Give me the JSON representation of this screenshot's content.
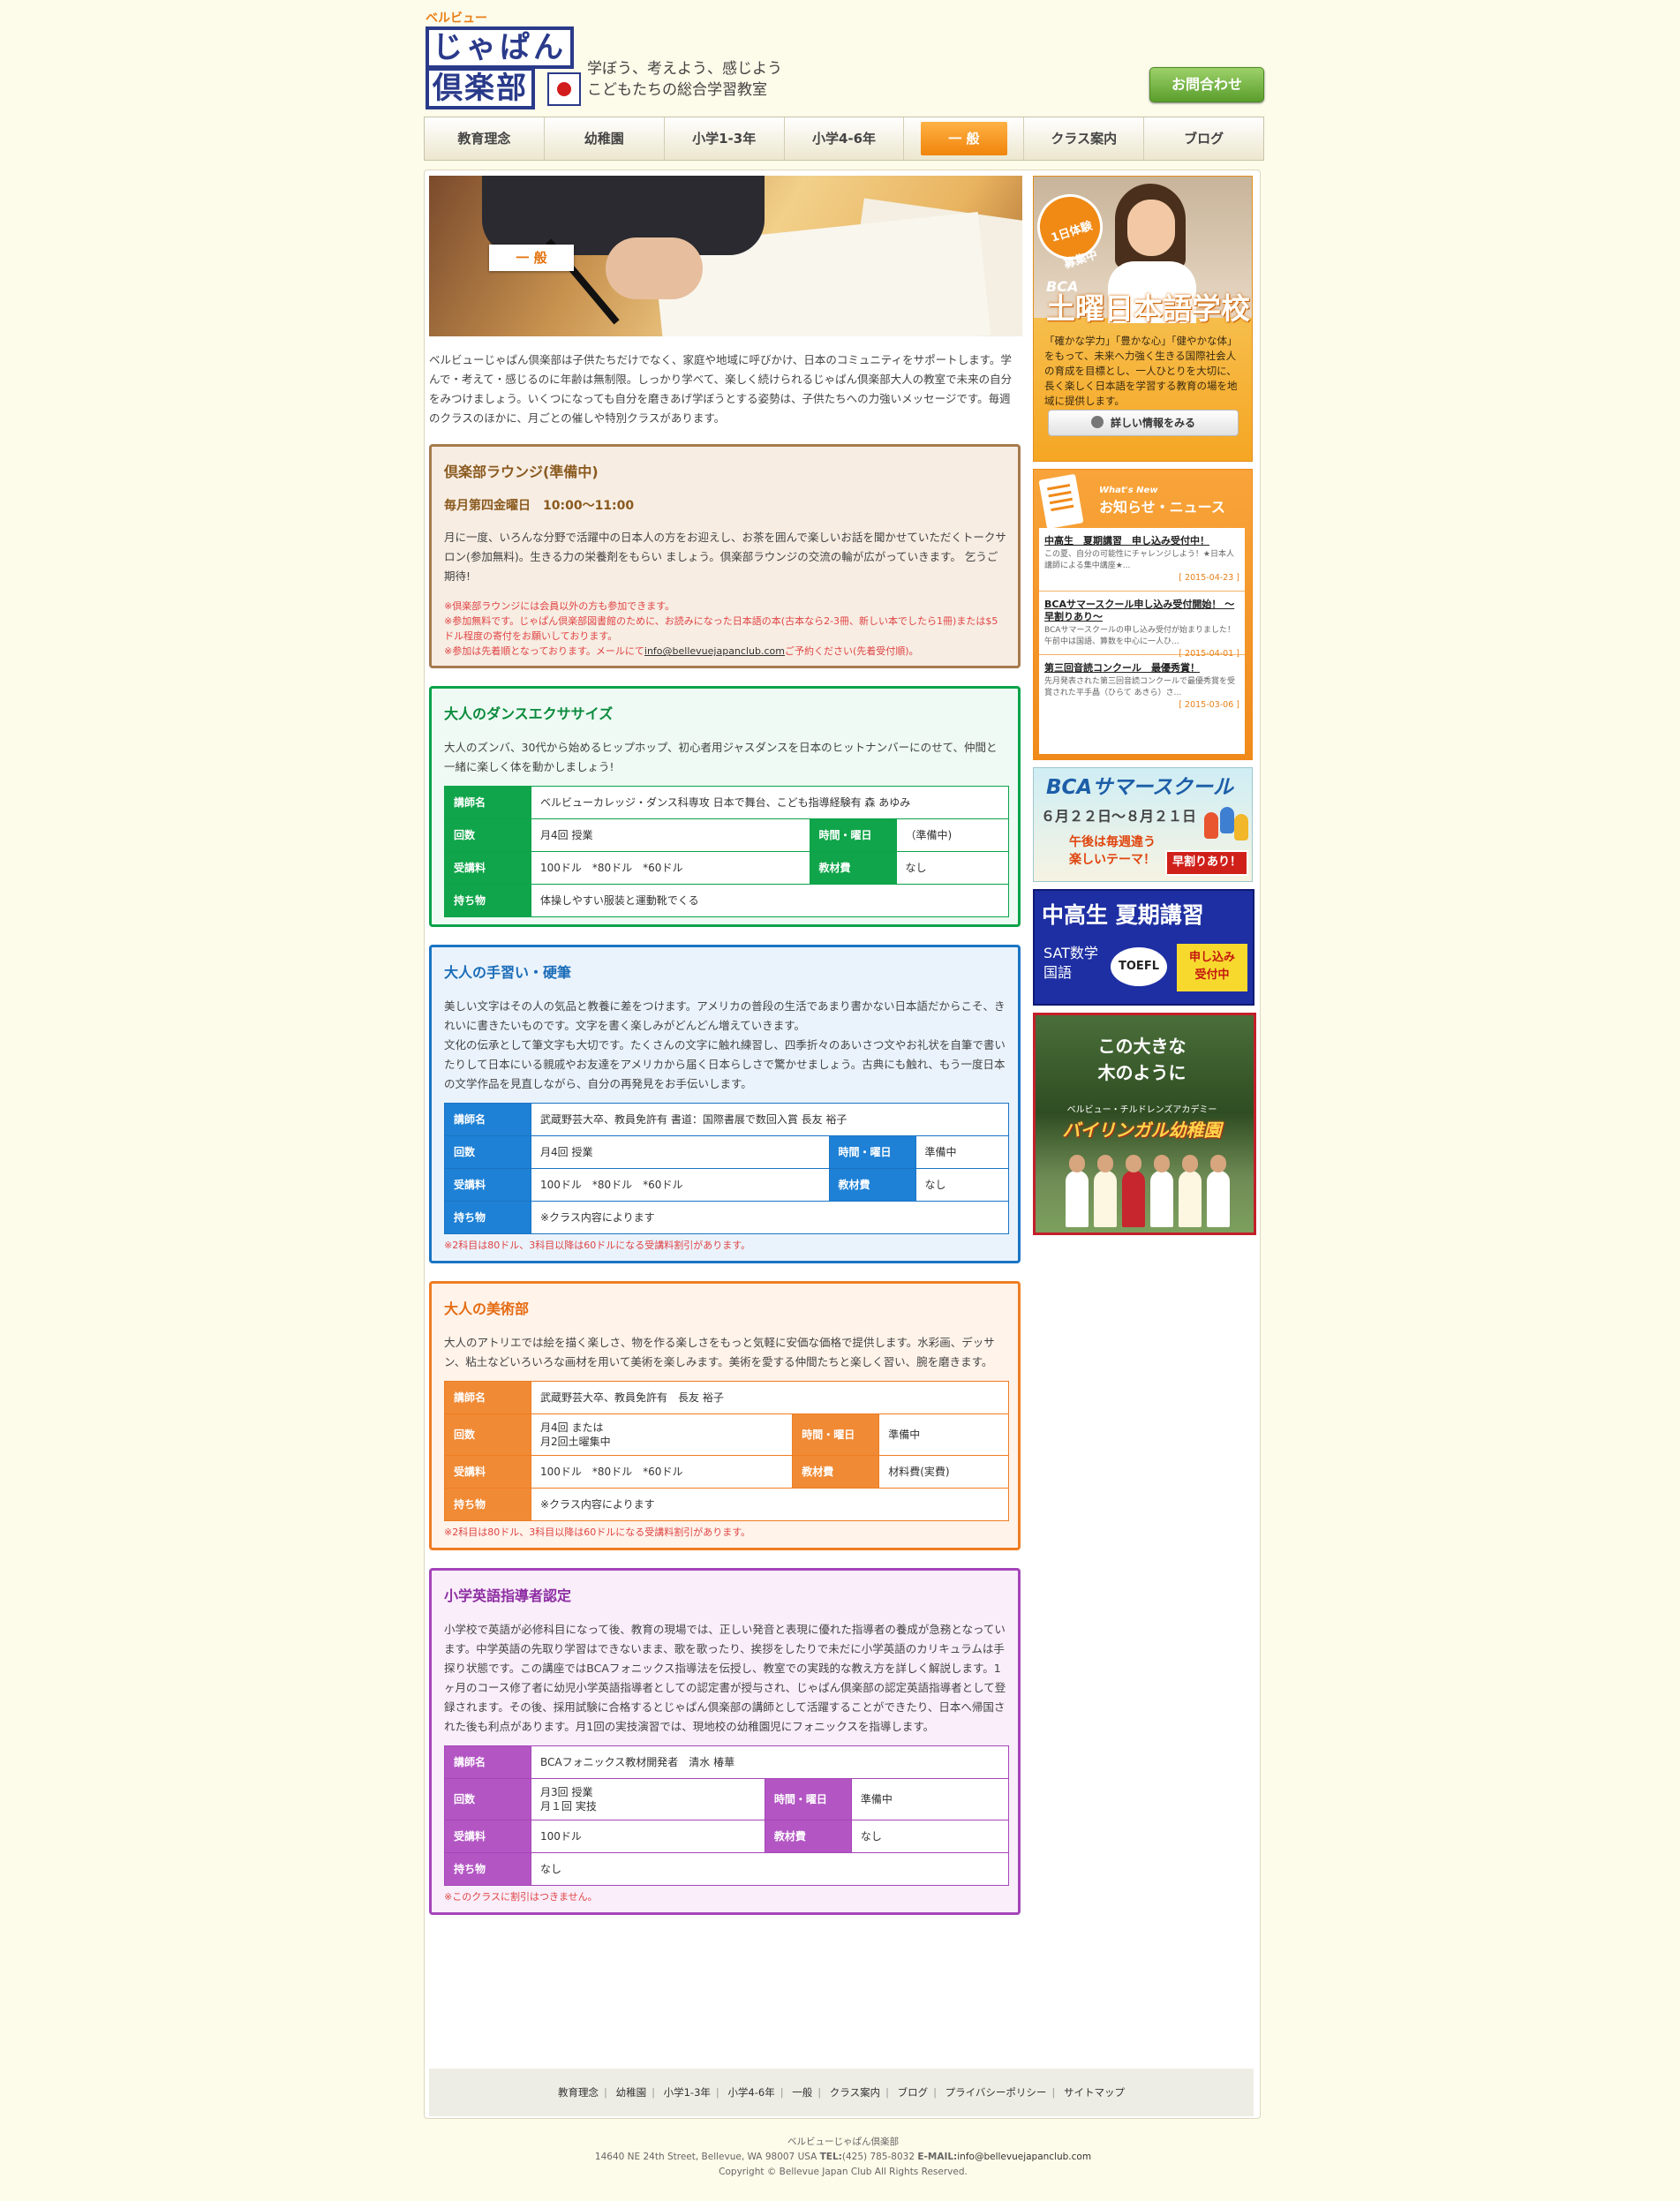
{
  "header": {
    "logo_kana": "ベルビュー",
    "logo_line1": "じゃぱん",
    "logo_line2": "倶楽部",
    "tagline_1": "学ぼう、考えよう、感じよう",
    "tagline_2": "こどもたちの総合学習教室",
    "contact_label": "お問合わせ"
  },
  "nav": {
    "items": [
      "教育理念",
      "幼稚園",
      "小学1-3年",
      "小学4-6年",
      "一 般",
      "クラス案内",
      "ブログ"
    ],
    "active_index": 4
  },
  "hero": {
    "badge": "一 般"
  },
  "intro": "ベルビューじゃぱん倶楽部は子供たちだけでなく、家庭や地域に呼びかけ、日本のコミュニティをサポートします。学んで・考えて・感じるのに年齢は無制限。しっかり学べて、楽しく続けられるじゃぱん倶楽部大人の教室で未来の自分をみつけましょう。いくつになっても自分を磨きあげ学ぼうとする姿勢は、子供たちへの力強いメッセージです。毎週のクラスのほかに、月ごとの催しや特別クラスがあります。",
  "sections": {
    "lounge": {
      "title": "倶楽部ラウンジ(準備中)",
      "schedule": "毎月第四金曜日　10:00～11:00",
      "body": "月に一度、いろんな分野で活躍中の日本人の方をお迎えし、お茶を囲んで楽しいお話を聞かせていただくトークサロン(参加無料)。生きる力の栄養剤をもらい ましょう。倶楽部ラウンジの交流の輪が広がっていきます。 乞うご期待!",
      "note1": "※倶楽部ラウンジには会員以外の方も参加できます。",
      "note2": "※参加無料です。じゃぱん倶楽部図書館のために、お読みになった日本語の本(古本なら2-3冊、新しい本でしたら1冊)または$5ドル程度の寄付をお願いしております。",
      "note3a": "※参加は先着順となっております。メールにて",
      "note3_email": "info@bellevuejapanclub.com",
      "note3b": "ご予約ください(先着受付順)。"
    },
    "dance": {
      "title": "大人のダンスエクササイズ",
      "body": "大人のズンバ、30代から始めるヒップホップ、初心者用ジャスダンスを日本のヒットナンバーにのせて、仲間と一緒に楽しく体を動かしましょう!",
      "labels": {
        "instructor": "講師名",
        "times": "回数",
        "day": "時間・曜日",
        "fee": "受講料",
        "materials": "教材費",
        "bring": "持ち物"
      },
      "instructor": "ベルビューカレッジ・ダンス科専攻 日本で舞台、こども指導経験有 森 あゆみ",
      "times": "月4回 授業",
      "day": "（準備中)",
      "fee": "100ドル　*80ドル　*60ドル",
      "materials": "なし",
      "bring": "体操しやすい服装と運動靴でくる"
    },
    "callig": {
      "title": "大人の手習い・硬筆",
      "body1": "美しい文字はその人の気品と教養に差をつけます。アメリカの普段の生活であまり書かない日本語だからこそ、きれいに書きたいものです。文字を書く楽しみがどんどん増えていきます。",
      "body2": "文化の伝承として筆文字も大切です。たくさんの文字に触れ練習し、四季折々のあいさつ文やお礼状を自筆で書いたりして日本にいる親戚やお友達をアメリカから届く日本らしさで驚かせましょう。古典にも触れ、もう一度日本の文学作品を見直しながら、自分の再発見をお手伝いします。",
      "labels": {
        "instructor": "講師名",
        "times": "回数",
        "day": "時間・曜日",
        "fee": "受講料",
        "materials": "教材費",
        "bring": "持ち物"
      },
      "instructor": "武蔵野芸大卒、教員免許有 書道：国際書展で数回入賞 長友 裕子",
      "times": "月4回 授業",
      "day": "準備中",
      "fee": "100ドル　*80ドル　*60ドル",
      "materials": "なし",
      "bring": "※クラス内容によります",
      "note": "※2科目は80ドル、3科目以降は60ドルになる受講料割引があります。"
    },
    "art": {
      "title": "大人の美術部",
      "body": "大人のアトリエでは絵を描く楽しさ、物を作る楽しさをもっと気軽に安価な価格で提供します。水彩画、デッサン、粘土などいろいろな画材を用いて美術を楽しみます。美術を愛する仲間たちと楽しく習い、腕を磨きます。",
      "labels": {
        "instructor": "講師名",
        "times": "回数",
        "day": "時間・曜日",
        "fee": "受講料",
        "materials": "教材費",
        "bring": "持ち物"
      },
      "instructor": "武蔵野芸大卒、教員免許有　長友 裕子",
      "times_1": "月4回 または",
      "times_2": "月2回土曜集中",
      "day": "準備中",
      "fee": "100ドル　*80ドル　*60ドル",
      "materials": "材料費(実費)",
      "bring": "※クラス内容によります",
      "note": "※2科目は80ドル、3科目以降は60ドルになる受講料割引があります。"
    },
    "eng": {
      "title": "小学英語指導者認定",
      "body": "小学校で英語が必修科目になって後、教育の現場では、正しい発音と表現に優れた指導者の養成が急務となっています。中学英語の先取り学習はできないまま、歌を歌ったり、挨拶をしたりで未だに小学英語のカリキュラムは手探り状態です。この講座ではBCAフォニックス指導法を伝授し、教室での実践的な教え方を詳しく解説します。1ヶ月のコース修了者に幼児小学英語指導者としての認定書が授与され、じゃぱん倶楽部の認定英語指導者として登録されます。その後、採用試験に合格するとじゃぱん倶楽部の講師として活躍することができたり、日本へ帰国された後も利点があります。月1回の実技演習では、現地校の幼稚園児にフォニックスを指導します。",
      "labels": {
        "instructor": "講師名",
        "times": "回数",
        "day": "時間・曜日",
        "fee": "受講料",
        "materials": "教材費",
        "bring": "持ち物"
      },
      "instructor": "BCAフォニックス教材開発者　清水 椿華",
      "times_1": "月3回 授業",
      "times_2": "月１回 実技",
      "day": "準備中",
      "fee": "100ドル",
      "materials": "なし",
      "bring": "なし",
      "note": "※このクラスに割引はつきません。"
    }
  },
  "sidebar": {
    "saturday": {
      "burst_1": "1日体験",
      "burst_2": "募集中",
      "brand": "BCA",
      "title": "土曜日本語学校",
      "desc": "「確かな学力」「豊かな心」「健やかな体」をもって、未来へ力強く生きる国際社会人の育成を目標とし、一人ひとりを大切に、長く楽しく日本語を学習する教育の場を地域に提供します。",
      "button": "詳しい情報をみる"
    },
    "news": {
      "en": "What's New",
      "ja": "お知らせ・ニュース",
      "items": [
        {
          "title": "中高生　夏期講習　申し込み受付中！",
          "body": "この夏、自分の可能性にチャレンジしよう！★日本人講師による集中講座★...",
          "date": "[ 2015-04-23 ]"
        },
        {
          "title": "BCAサマースクール申し込み受付開始！ ～早割りあり～",
          "body": "BCAサマースクールの申し込み受付が始まりました！午前中は国語、算数を中心に一人ひ...",
          "date": "[ 2015-04-01 ]"
        },
        {
          "title": "第三回音読コンクール　最優秀賞！",
          "body": "先月発表された第三回音読コンクールで最優秀賞を受賞された平手晶（ひらて あきら）さ...",
          "date": "[ 2015-03-06 ]"
        }
      ]
    },
    "summer": {
      "title": "BCAサマースクール",
      "dates": "６月２２日～８月２１日",
      "sub1": "午後は毎週違う",
      "sub2": "楽しいテーマ！",
      "badge": "早割りあり！"
    },
    "summer2": {
      "title": "中高生 夏期講習",
      "s1": "SAT数学",
      "s2": "国語",
      "toefl": "TOEFL",
      "cta1": "申し込み",
      "cta2": "受付中"
    },
    "preschool": {
      "t1": "この大きな",
      "t2": "木のように",
      "sub": "ベルビュー・チルドレンズアカデミー",
      "title": "バイリンガル幼稚園"
    }
  },
  "footer": {
    "links": [
      "教育理念",
      "幼稚園",
      "小学1-3年",
      "小学4-6年",
      "一般",
      "クラス案内",
      "ブログ",
      "プライバシーポリシー",
      "サイトマップ"
    ],
    "org": "ベルビューじゃぱん倶楽部",
    "address": "14640 NE 24th Street, Bellevue, WA 98007 USA",
    "tel_label": "TEL:",
    "tel": "(425) 785-8032",
    "email_label": "E-MAIL:",
    "email": "info@bellevuejapanclub.com",
    "copyright": "Copyright © Bellevue Japan Club All Rights Reserved."
  }
}
